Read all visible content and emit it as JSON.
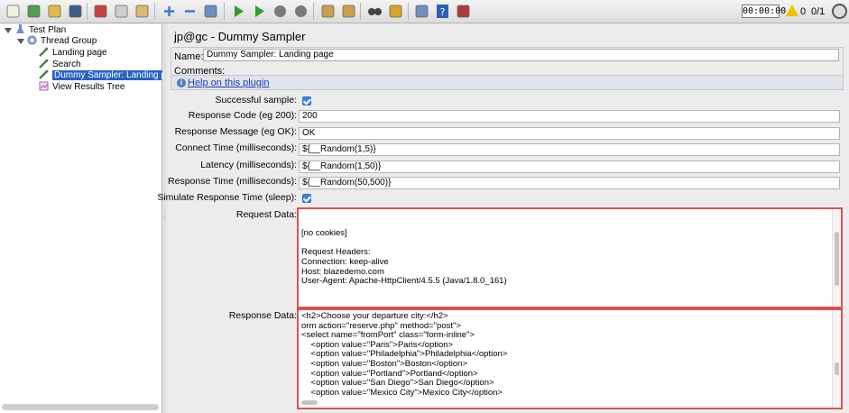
{
  "toolbar": {
    "icons": [
      "new-icon",
      "templates-icon",
      "open-icon",
      "save-icon",
      "cut-icon",
      "copy-icon",
      "paste-icon",
      "expand-icon",
      "collapse-icon",
      "toggle-icon",
      "start-icon",
      "start-no-pauses-icon",
      "stop-icon",
      "shutdown-icon",
      "clear-icon",
      "clear-all-icon",
      "search-icon",
      "reset-search-icon",
      "function-helper-icon",
      "help-icon",
      "remote-icon"
    ],
    "timer": "00:00:00",
    "warning_count": "0",
    "threads": "0/1",
    "colors": {
      "start": "#2e9d2e",
      "stop": "#7a7a7a",
      "selection": "#2a62c5",
      "highlight_border": "#d9534f"
    }
  },
  "tree": {
    "nodes": [
      {
        "label": "Test Plan",
        "icon": "test-plan-icon"
      },
      {
        "label": "Thread Group",
        "icon": "thread-group-icon"
      },
      {
        "label": "Landing page",
        "icon": "sampler-icon"
      },
      {
        "label": "Search",
        "icon": "sampler-icon"
      },
      {
        "label": "Dummy Sampler: Landing page",
        "icon": "sampler-icon",
        "selected": true
      },
      {
        "label": "View Results Tree",
        "icon": "listener-icon"
      }
    ]
  },
  "panel": {
    "title": "jp@gc - Dummy Sampler",
    "name_label": "Name:",
    "name_value": "Dummy Sampler: Landing page",
    "comments_label": "Comments:",
    "help_link": "Help on this plugin",
    "fields": [
      {
        "label": "Successful sample:",
        "type": "checkbox",
        "checked": true
      },
      {
        "label": "Response Code (eg 200):",
        "type": "text",
        "value": "200"
      },
      {
        "label": "Response Message (eg OK):",
        "type": "text",
        "value": "OK"
      },
      {
        "label": "Connect Time (milliseconds):",
        "type": "text",
        "value": "${__Random(1,5)}"
      },
      {
        "label": "Latency (milliseconds):",
        "type": "text",
        "value": "${__Random(1,50)}"
      },
      {
        "label": "Response Time (milliseconds):",
        "type": "text",
        "value": "${__Random(50,500)}"
      },
      {
        "label": "Simulate Response Time (sleep):",
        "type": "checkbox",
        "checked": true
      }
    ],
    "request_label": "Request Data:",
    "request_lines": [
      "",
      "",
      "[no cookies]",
      "",
      "Request Headers:",
      "Connection: keep-alive",
      "Host: blazedemo.com",
      "User-Agent: Apache-HttpClient/4.5.5 (Java/1.8.0_161)"
    ],
    "response_label": "Response Data:",
    "response_lines": [
      "<h2>Choose your departure city:</h2>",
      "orm action=\"reserve.php\" method=\"post\">",
      "<select name=\"fromPort\" class=\"form-inline\">",
      "    <option value=\"Paris\">Paris</option>",
      "    <option value=\"Philadelphia\">Philadelphia</option>",
      "    <option value=\"Boston\">Boston</option>",
      "    <option value=\"Portland\">Portland</option>",
      "    <option value=\"San Diego\">San Diego</option>",
      "    <option value=\"Mexico City\">Mexico City</option>"
    ]
  }
}
